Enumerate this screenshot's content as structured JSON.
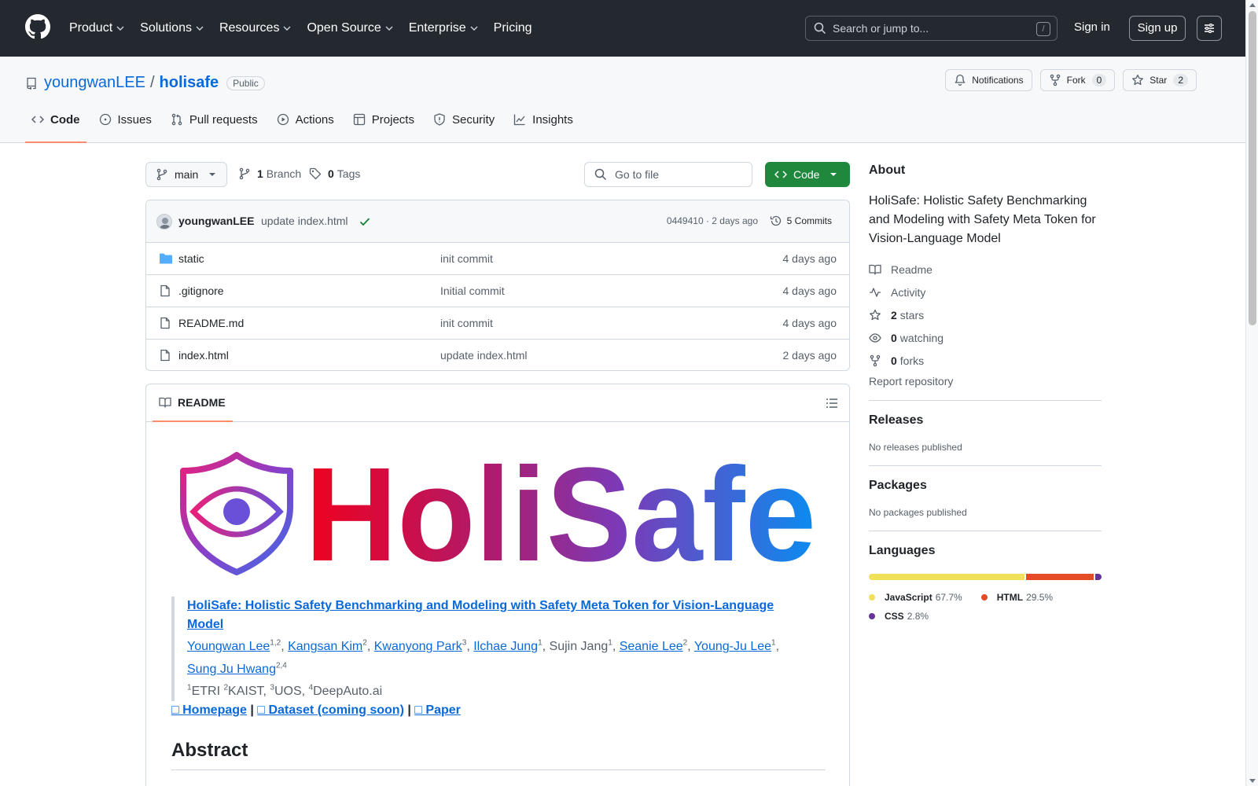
{
  "header": {
    "nav": [
      "Product",
      "Solutions",
      "Resources",
      "Open Source",
      "Enterprise",
      "Pricing"
    ],
    "search_placeholder": "Search or jump to...",
    "search_shortcut": "/",
    "signin": "Sign in",
    "signup": "Sign up"
  },
  "repo": {
    "owner": "youngwanLEE",
    "separator": "/",
    "name": "holisafe",
    "visibility": "Public",
    "notifications_label": "Notifications",
    "fork_label": "Fork",
    "fork_count": "0",
    "star_label": "Star",
    "star_count": "2",
    "tabs": [
      "Code",
      "Issues",
      "Pull requests",
      "Actions",
      "Projects",
      "Security",
      "Insights"
    ]
  },
  "toolbar": {
    "branch": "main",
    "branch_count": "1",
    "branch_label": "Branch",
    "tag_count": "0",
    "tag_label": "Tags",
    "goto_placeholder": "Go to file",
    "code_button": "Code"
  },
  "commit": {
    "author": "youngwanLEE",
    "message": "update index.html",
    "meta": "0449410 · 2 days ago",
    "count_label": "5 Commits"
  },
  "files": [
    {
      "name": "static",
      "type": "folder",
      "commit": "init commit",
      "time": "4 days ago"
    },
    {
      "name": ".gitignore",
      "type": "file",
      "commit": "Initial commit",
      "time": "4 days ago"
    },
    {
      "name": "README.md",
      "type": "file",
      "commit": "init commit",
      "time": "4 days ago"
    },
    {
      "name": "index.html",
      "type": "file",
      "commit": "update index.html",
      "time": "2 days ago"
    }
  ],
  "readme": {
    "tab_label": "README",
    "logo_text": "HoliSafe",
    "paper_title": "HoliSafe: Holistic Safety Benchmarking and Modeling with Safety Meta Token for Vision-Language Model",
    "authors": [
      {
        "name": "Youngwan Lee",
        "sup": "1,2",
        "link": true
      },
      {
        "name": "Kangsan Kim",
        "sup": "2",
        "link": true
      },
      {
        "name": "Kwanyong Park",
        "sup": "3",
        "link": true
      },
      {
        "name": "Ilchae Jung",
        "sup": "1",
        "link": true
      },
      {
        "name": "Sujin Jang",
        "sup": "1",
        "link": false
      },
      {
        "name": "Seanie Lee",
        "sup": "2",
        "link": true
      },
      {
        "name": "Young-Ju Lee",
        "sup": "1",
        "link": true
      },
      {
        "name": "Sung Ju Hwang",
        "sup": "2,4",
        "link": true
      }
    ],
    "affiliations": [
      {
        "sup": "1",
        "name": "ETRI"
      },
      {
        "sup": "2",
        "name": "KAIST,"
      },
      {
        "sup": "3",
        "name": "UOS,"
      },
      {
        "sup": "4",
        "name": "DeepAuto.ai"
      }
    ],
    "links": [
      "Homepage",
      "Dataset (coming soon)",
      "Paper"
    ],
    "link_separator": "|",
    "link_glyph": "□",
    "abstract_heading": "Abstract"
  },
  "sidebar": {
    "about_heading": "About",
    "description": "HoliSafe: Holistic Safety Benchmarking and Modeling with Safety Meta Token for Vision-Language Model",
    "readme": "Readme",
    "activity": "Activity",
    "stars_count": "2",
    "stars_label": "stars",
    "watching_count": "0",
    "watching_label": "watching",
    "forks_count": "0",
    "forks_label": "forks",
    "report": "Report repository",
    "releases_heading": "Releases",
    "releases_note": "No releases published",
    "packages_heading": "Packages",
    "packages_note": "No packages published",
    "languages_heading": "Languages",
    "languages": [
      {
        "name": "JavaScript",
        "pct": "67.7%",
        "value": 67.7,
        "color": "#f1e05a"
      },
      {
        "name": "HTML",
        "pct": "29.5%",
        "value": 29.5,
        "color": "#e34c26"
      },
      {
        "name": "CSS",
        "pct": "2.8%",
        "value": 2.8,
        "color": "#663399"
      }
    ]
  },
  "colors": {
    "header_bg": "#24292f",
    "link": "#0969da",
    "code_button": "#1f883d",
    "active_tab_underline": "#fd8c73"
  }
}
